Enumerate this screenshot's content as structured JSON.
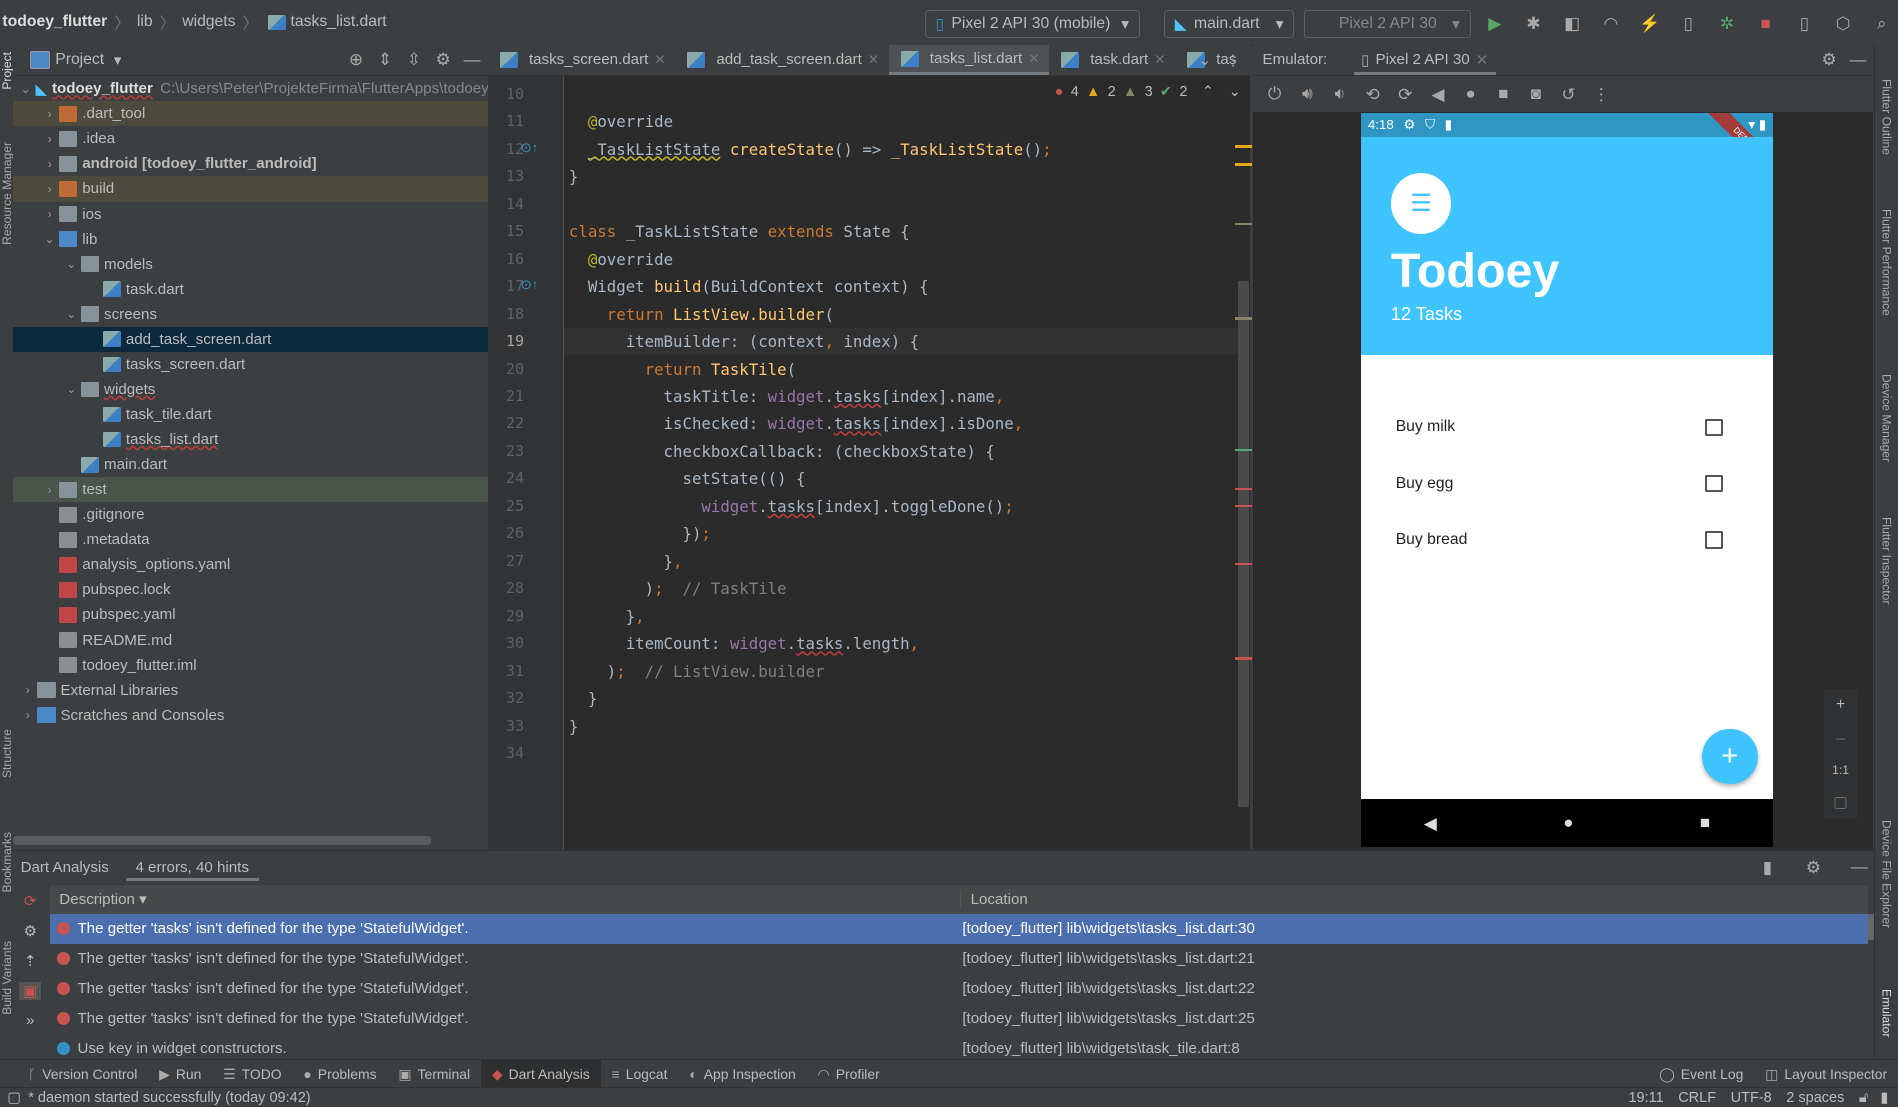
{
  "breadcrumb": [
    "todoey_flutter",
    "lib",
    "widgets",
    "tasks_list.dart"
  ],
  "toolbar": {
    "device": "Pixel 2 API 30 (mobile)",
    "run_config": "main.dart",
    "avd": "Pixel 2 API 30"
  },
  "project": {
    "title": "Project",
    "root_name": "todoey_flutter",
    "root_path": "C:\\Users\\Peter\\ProjekteFirma\\FlutterApps\\todoey_flutter",
    "items": [
      {
        "label": ".dart_tool",
        "depth": 1,
        "arrow": "right",
        "icon": "folder-orange",
        "hl": "excluded"
      },
      {
        "label": ".idea",
        "depth": 1,
        "arrow": "right",
        "icon": "folder"
      },
      {
        "label": "android [todoey_flutter_android]",
        "depth": 1,
        "arrow": "right",
        "icon": "folder",
        "bold": true
      },
      {
        "label": "build",
        "depth": 1,
        "arrow": "right",
        "icon": "folder-orange",
        "hl": "excluded"
      },
      {
        "label": "ios",
        "depth": 1,
        "arrow": "right",
        "icon": "folder"
      },
      {
        "label": "lib",
        "depth": 1,
        "arrow": "down",
        "icon": "folder-blue"
      },
      {
        "label": "models",
        "depth": 2,
        "arrow": "down",
        "icon": "folder"
      },
      {
        "label": "task.dart",
        "depth": 3,
        "icon": "dart"
      },
      {
        "label": "screens",
        "depth": 2,
        "arrow": "down",
        "icon": "folder"
      },
      {
        "label": "add_task_screen.dart",
        "depth": 3,
        "icon": "dart",
        "hl": "selected"
      },
      {
        "label": "tasks_screen.dart",
        "depth": 3,
        "icon": "dart"
      },
      {
        "label": "widgets",
        "depth": 2,
        "arrow": "down",
        "icon": "folder",
        "err": true
      },
      {
        "label": "task_tile.dart",
        "depth": 3,
        "icon": "dart"
      },
      {
        "label": "tasks_list.dart",
        "depth": 3,
        "icon": "dart",
        "err": true
      },
      {
        "label": "main.dart",
        "depth": 2,
        "icon": "dart"
      },
      {
        "label": "test",
        "depth": 1,
        "arrow": "right",
        "icon": "folder",
        "hl": "test"
      },
      {
        "label": ".gitignore",
        "depth": 1,
        "icon": "file"
      },
      {
        "label": ".metadata",
        "depth": 1,
        "icon": "file"
      },
      {
        "label": "analysis_options.yaml",
        "depth": 1,
        "icon": "yml"
      },
      {
        "label": "pubspec.lock",
        "depth": 1,
        "icon": "yml"
      },
      {
        "label": "pubspec.yaml",
        "depth": 1,
        "icon": "yml"
      },
      {
        "label": "README.md",
        "depth": 1,
        "icon": "file"
      },
      {
        "label": "todoey_flutter.iml",
        "depth": 1,
        "icon": "file"
      },
      {
        "label": "External Libraries",
        "depth": 0,
        "arrow": "right",
        "icon": "lib"
      },
      {
        "label": "Scratches and Consoles",
        "depth": 0,
        "arrow": "right",
        "icon": "scratch"
      }
    ]
  },
  "editor": {
    "tabs": [
      {
        "label": "tasks_screen.dart"
      },
      {
        "label": "add_task_screen.dart"
      },
      {
        "label": "tasks_list.dart",
        "active": true
      },
      {
        "label": "task.dart"
      },
      {
        "label": "tas"
      }
    ],
    "inspections": {
      "errors": "4",
      "warnings": "2",
      "weak_warnings": "3",
      "typos": "2"
    },
    "current_line": 19,
    "lines": [
      {
        "n": 10,
        "t": []
      },
      {
        "n": 11,
        "t": [
          [
            "  ",
            ""
          ],
          [
            "@",
            "a"
          ],
          [
            "override",
            "t"
          ]
        ]
      },
      {
        "n": 12,
        "t": [
          [
            "  ",
            ""
          ],
          [
            "_TaskListState",
            "t wavy"
          ],
          [
            " ",
            ""
          ],
          [
            "createState",
            "f"
          ],
          [
            "() => ",
            "t"
          ],
          [
            "_TaskListState",
            "f"
          ],
          [
            "()",
            "t"
          ],
          [
            ";",
            "k"
          ]
        ]
      },
      {
        "n": 13,
        "t": [
          [
            "}",
            "t"
          ]
        ]
      },
      {
        "n": 14,
        "t": []
      },
      {
        "n": 15,
        "t": [
          [
            "class ",
            "k"
          ],
          [
            "_TaskListState ",
            "t"
          ],
          [
            "extends ",
            "k"
          ],
          [
            "State {",
            "t"
          ]
        ]
      },
      {
        "n": 16,
        "t": [
          [
            "  ",
            ""
          ],
          [
            "@",
            "a"
          ],
          [
            "override",
            "t"
          ]
        ]
      },
      {
        "n": 17,
        "t": [
          [
            "  Widget ",
            "t"
          ],
          [
            "build",
            "f"
          ],
          [
            "(BuildContext context) {",
            "t"
          ]
        ]
      },
      {
        "n": 18,
        "t": [
          [
            "    ",
            ""
          ],
          [
            "return ",
            "k"
          ],
          [
            "ListView.",
            "f"
          ],
          [
            "builder",
            "f"
          ],
          [
            "(",
            "t"
          ]
        ]
      },
      {
        "n": 19,
        "t": [
          [
            "      itemBuilder: (context",
            "t"
          ],
          [
            ", ",
            "k"
          ],
          [
            "index) {",
            "t"
          ]
        ]
      },
      {
        "n": 20,
        "t": [
          [
            "        ",
            ""
          ],
          [
            "return ",
            "k"
          ],
          [
            "TaskTile",
            "f"
          ],
          [
            "(",
            "t"
          ]
        ]
      },
      {
        "n": 21,
        "t": [
          [
            "          taskTitle: ",
            "t"
          ],
          [
            "widget",
            "p"
          ],
          [
            ".",
            "t"
          ],
          [
            "tasks",
            "t err"
          ],
          [
            "[index].name",
            "t"
          ],
          [
            ",",
            "k"
          ]
        ]
      },
      {
        "n": 22,
        "t": [
          [
            "          isChecked: ",
            "t"
          ],
          [
            "widget",
            "p"
          ],
          [
            ".",
            "t"
          ],
          [
            "tasks",
            "t err"
          ],
          [
            "[index].isDone",
            "t"
          ],
          [
            ",",
            "k"
          ]
        ]
      },
      {
        "n": 23,
        "t": [
          [
            "          checkboxCallback: (checkboxState) {",
            "t"
          ]
        ]
      },
      {
        "n": 24,
        "t": [
          [
            "            setState(() {",
            "t"
          ]
        ]
      },
      {
        "n": 25,
        "t": [
          [
            "              ",
            ""
          ],
          [
            "widget",
            "p"
          ],
          [
            ".",
            "t"
          ],
          [
            "tasks",
            "t err"
          ],
          [
            "[index].toggleDone()",
            "t"
          ],
          [
            ";",
            "k"
          ]
        ]
      },
      {
        "n": 26,
        "t": [
          [
            "            })",
            "t"
          ],
          [
            ";",
            "k"
          ]
        ]
      },
      {
        "n": 27,
        "t": [
          [
            "          }",
            "t"
          ],
          [
            ",",
            "k"
          ]
        ]
      },
      {
        "n": 28,
        "t": [
          [
            "        )",
            "t"
          ],
          [
            ";",
            "k"
          ],
          [
            "  // TaskTile",
            "c"
          ]
        ]
      },
      {
        "n": 29,
        "t": [
          [
            "      }",
            "t"
          ],
          [
            ",",
            "k"
          ]
        ]
      },
      {
        "n": 30,
        "t": [
          [
            "      itemCount: ",
            "t"
          ],
          [
            "widget",
            "p"
          ],
          [
            ".",
            "t"
          ],
          [
            "tasks",
            "t err"
          ],
          [
            ".length",
            "t"
          ],
          [
            ",",
            "k"
          ]
        ]
      },
      {
        "n": 31,
        "t": [
          [
            "    )",
            "t"
          ],
          [
            ";",
            "k"
          ],
          [
            "  // ListView.builder",
            "c"
          ]
        ]
      },
      {
        "n": 32,
        "t": [
          [
            "  }",
            "t"
          ]
        ]
      },
      {
        "n": 33,
        "t": [
          [
            "}",
            "t"
          ]
        ]
      },
      {
        "n": 34,
        "t": []
      }
    ]
  },
  "emulator": {
    "label": "Emulator:",
    "tab": "Pixel 2 API 30",
    "phone": {
      "time": "4:18",
      "title": "Todoey",
      "subtitle": "12 Tasks",
      "tasks": [
        {
          "name": "Buy milk",
          "done": false
        },
        {
          "name": "Buy egg",
          "done": false
        },
        {
          "name": "Buy bread",
          "done": false
        }
      ],
      "accent": "#40c4ff",
      "debug_banner": "DEBUG"
    },
    "zoom_controls": {
      "plus": "+",
      "minus": "–",
      "one_to_one": "1:1"
    }
  },
  "analysis": {
    "title": "Dart Analysis",
    "summary": "4 errors, 40 hints",
    "col_description": "Description",
    "col_location": "Location",
    "rows": [
      {
        "severity": "error",
        "text": "The getter 'tasks' isn't defined for the type 'StatefulWidget'.",
        "location": "[todoey_flutter] lib\\widgets\\tasks_list.dart:30",
        "selected": true
      },
      {
        "severity": "error",
        "text": "The getter 'tasks' isn't defined for the type 'StatefulWidget'.",
        "location": "[todoey_flutter] lib\\widgets\\tasks_list.dart:21"
      },
      {
        "severity": "error",
        "text": "The getter 'tasks' isn't defined for the type 'StatefulWidget'.",
        "location": "[todoey_flutter] lib\\widgets\\tasks_list.dart:22"
      },
      {
        "severity": "error",
        "text": "The getter 'tasks' isn't defined for the type 'StatefulWidget'.",
        "location": "[todoey_flutter] lib\\widgets\\tasks_list.dart:25"
      },
      {
        "severity": "info",
        "text": "Use key in widget constructors.",
        "location": "[todoey_flutter] lib\\widgets\\task_tile.dart:8"
      }
    ]
  },
  "toolwindows": [
    {
      "label": "Version Control",
      "icon": "branch-icon"
    },
    {
      "label": "Run",
      "icon": "play-icon"
    },
    {
      "label": "TODO",
      "icon": "list-icon"
    },
    {
      "label": "Problems",
      "icon": "problems-icon"
    },
    {
      "label": "Terminal",
      "icon": "terminal-icon"
    },
    {
      "label": "Dart Analysis",
      "icon": "dart-icon",
      "active": true
    },
    {
      "label": "Logcat",
      "icon": "logcat-icon"
    },
    {
      "label": "App Inspection",
      "icon": "inspection-icon"
    },
    {
      "label": "Profiler",
      "icon": "profiler-icon"
    }
  ],
  "toolwindows_right": [
    {
      "label": "Event Log",
      "icon": "event-log-icon"
    },
    {
      "label": "Layout Inspector",
      "icon": "layout-inspector-icon"
    }
  ],
  "side_left": [
    "Project",
    "Resource Manager",
    "Structure",
    "Bookmarks",
    "Build Variants"
  ],
  "side_right": [
    "Flutter Outline",
    "Flutter Performance",
    "Device Manager",
    "Flutter Inspector",
    "Device File Explorer",
    "Emulator"
  ],
  "status": {
    "message": "* daemon started successfully (today 09:42)",
    "position": "19:11",
    "line_sep": "CRLF",
    "encoding": "UTF-8",
    "indent": "2 spaces"
  }
}
